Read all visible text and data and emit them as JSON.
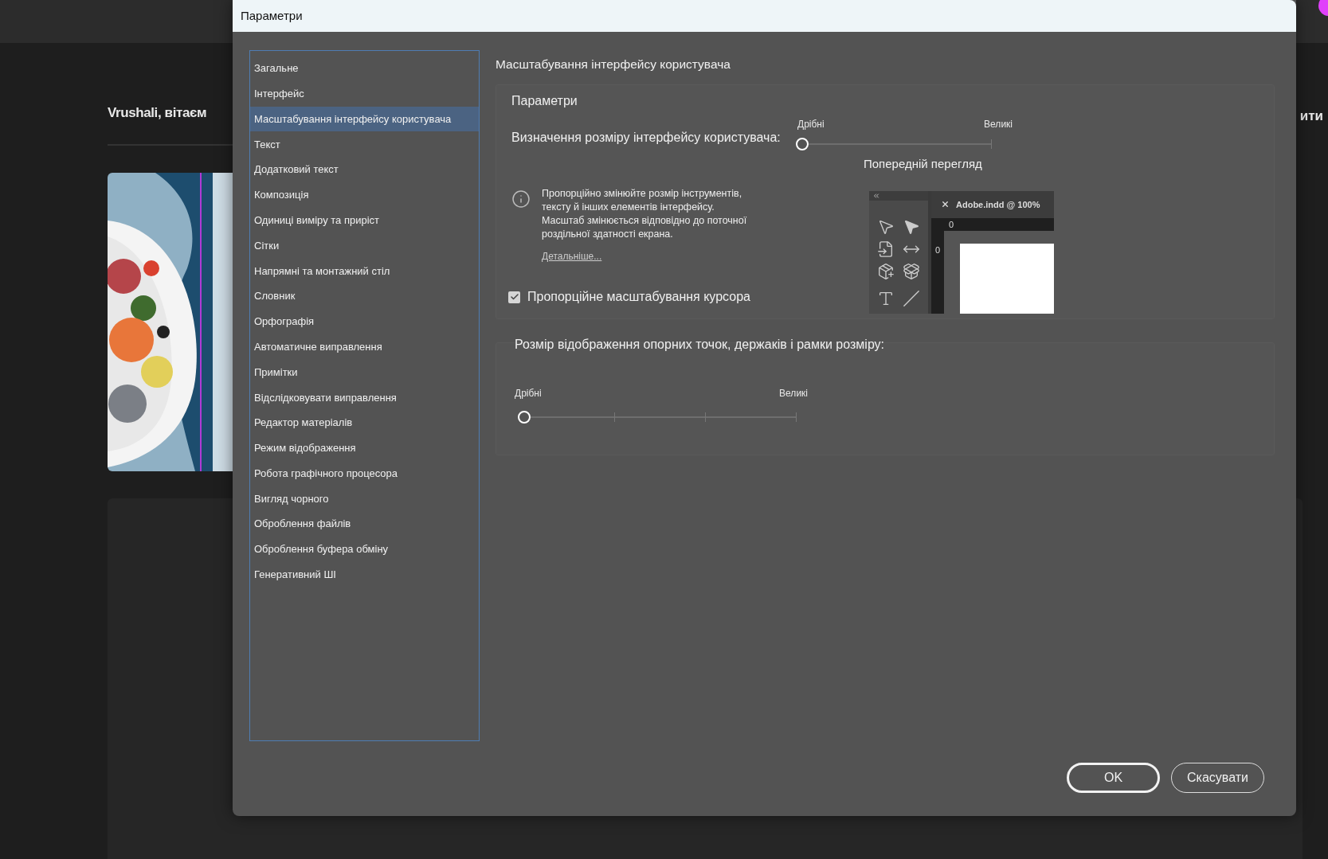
{
  "background": {
    "greeting": "Vrushali, вітаєм",
    "side_text": "ити"
  },
  "dialog": {
    "title": "Параметри",
    "sidebar": {
      "items": [
        {
          "label": "Загальне",
          "selected": false
        },
        {
          "label": "Інтерфейс",
          "selected": false
        },
        {
          "label": "Масштабування інтерфейсу користувача",
          "selected": true
        },
        {
          "label": "Текст",
          "selected": false
        },
        {
          "label": "Додатковий текст",
          "selected": false
        },
        {
          "label": "Композиція",
          "selected": false
        },
        {
          "label": "Одиниці виміру та приріст",
          "selected": false
        },
        {
          "label": "Сітки",
          "selected": false
        },
        {
          "label": "Напрямні та монтажний стіл",
          "selected": false
        },
        {
          "label": "Словник",
          "selected": false
        },
        {
          "label": "Орфографія",
          "selected": false
        },
        {
          "label": "Автоматичне виправлення",
          "selected": false
        },
        {
          "label": "Примітки",
          "selected": false
        },
        {
          "label": "Відслідковувати виправлення",
          "selected": false
        },
        {
          "label": "Редактор матеріалів",
          "selected": false
        },
        {
          "label": "Режим відображення",
          "selected": false
        },
        {
          "label": "Робота графічного процесора",
          "selected": false
        },
        {
          "label": "Вигляд чорного",
          "selected": false
        },
        {
          "label": "Оброблення файлів",
          "selected": false
        },
        {
          "label": "Оброблення буфера обміну",
          "selected": false
        },
        {
          "label": "Генеративний ШІ",
          "selected": false
        }
      ]
    },
    "panel": {
      "heading": "Масштабування інтерфейсу користувача",
      "group_title": "Параметри",
      "ui_scale": {
        "label": "Визначення розміру інтерфейсу користувача:",
        "min_label": "Дрібні",
        "max_label": "Великі",
        "level": 0
      },
      "preview": {
        "title": "Попередній перегляд",
        "tab_title": "Adobe.indd @ 100%",
        "ruler_h": "0",
        "ruler_v": "0"
      },
      "info": {
        "text": "Пропорційно змінюйте розмір інструментів,\nтексту й інших елементів інтерфейсу.\nМасштаб змінюється відповідно до поточної\nроздільної здатності екрана.",
        "link": "Детальніше..."
      },
      "cursor_scaling": {
        "label": "Пропорційне масштабування курсора",
        "checked": true
      },
      "handle_size": {
        "label": "Розмір відображення опорних точок, держаків і рамки розміру:",
        "min_label": "Дрібні",
        "max_label": "Великі",
        "level": 0
      }
    },
    "buttons": [
      {
        "label": "OK",
        "kind": "primary"
      },
      {
        "label": "Скасувати",
        "kind": "secondary"
      }
    ]
  }
}
